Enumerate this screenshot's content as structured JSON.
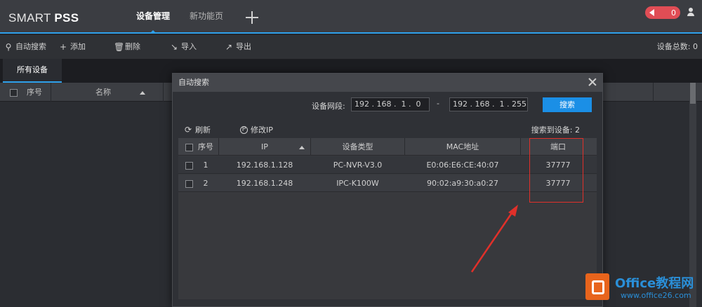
{
  "app": {
    "logo_prefix": "SMART ",
    "logo_bold": "PSS"
  },
  "top_tabs": [
    {
      "label": "设备管理",
      "active": true
    },
    {
      "label": "新功能页",
      "active": false
    }
  ],
  "alarm": {
    "count": "0"
  },
  "toolbar": {
    "auto_search": "自动搜索",
    "add": "添加",
    "delete": "删除",
    "import": "导入",
    "export": "导出",
    "device_total_label": "设备总数:",
    "device_total": "0"
  },
  "device_tabs": {
    "all_devices": "所有设备"
  },
  "list_header": {
    "index": "序号",
    "name": "名称"
  },
  "dialog": {
    "title": "自动搜索",
    "segment_label": "设备网段:",
    "ip_start": "192 . 168 .  1 .  0",
    "ip_end": "192 . 168 .  1 . 255",
    "search_button": "搜索",
    "refresh": "刷新",
    "modify_ip": "修改IP",
    "found_label": "搜索到设备:",
    "found_count": "2",
    "columns": {
      "index": "序号",
      "ip": "IP",
      "type": "设备类型",
      "mac": "MAC地址",
      "port": "端口"
    },
    "rows": [
      {
        "index": "1",
        "ip": "192.168.1.128",
        "type": "PC-NVR-V3.0",
        "mac": "E0:06:E6:CE:40:07",
        "port": "37777"
      },
      {
        "index": "2",
        "ip": "192.168.1.248",
        "type": "IPC-K100W",
        "mac": "90:02:a9:30:a0:27",
        "port": "37777"
      }
    ]
  },
  "watermark": {
    "title": "Office教程网",
    "url": "www.office26.com"
  },
  "colors": {
    "accent": "#2ea0ea",
    "search_button": "#1b8fe6",
    "alarm": "#e04d55",
    "annotation": "#e0302a",
    "brand": "#e8641c"
  }
}
